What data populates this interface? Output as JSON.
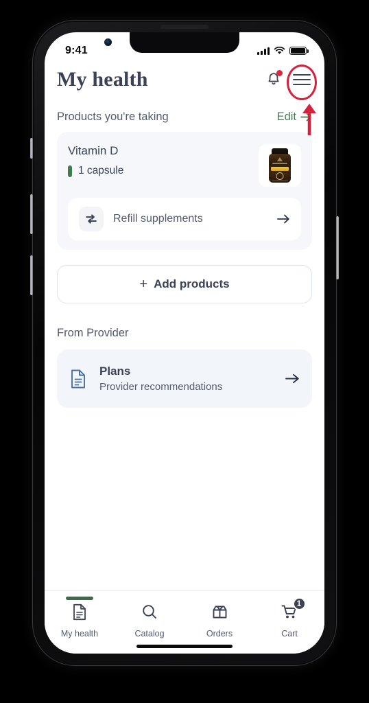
{
  "status_bar": {
    "time": "9:41",
    "signal_icon": "cellular-signal-icon",
    "wifi_icon": "wifi-icon",
    "battery_icon": "battery-full-icon"
  },
  "header": {
    "title": "My health",
    "notifications_icon": "bell-icon",
    "menu_icon": "hamburger-menu-icon",
    "has_notification_dot": true
  },
  "annotation": {
    "highlight_color": "#d4213c",
    "target": "hamburger-menu-icon",
    "shape": "ellipse-with-up-arrow"
  },
  "products_section": {
    "title": "Products you're taking",
    "edit_label": "Edit",
    "edit_arrow": "arrow-right-icon",
    "edit_color": "#4a7a5e",
    "items": [
      {
        "name": "Vitamin D",
        "dose": "1 capsule",
        "dose_marker_color": "#3f7a52",
        "thumbnail": "supplement-bottle-image"
      }
    ],
    "refill": {
      "label": "Refill supplements",
      "icon": "refresh-swap-icon",
      "arrow": "arrow-right-icon"
    },
    "add_button": {
      "plus": "+",
      "label": "Add products"
    }
  },
  "provider_section": {
    "title": "From Provider",
    "cards": [
      {
        "icon": "document-icon",
        "icon_color": "#4a6fa5",
        "title": "Plans",
        "subtitle": "Provider recommendations",
        "arrow": "arrow-right-icon"
      }
    ]
  },
  "tabbar": {
    "active_index": 0,
    "active_indicator_color": "#3f6b4a",
    "tabs": [
      {
        "label": "My health",
        "icon": "document-icon",
        "badge": ""
      },
      {
        "label": "Catalog",
        "icon": "search-icon",
        "badge": ""
      },
      {
        "label": "Orders",
        "icon": "open-box-icon",
        "badge": ""
      },
      {
        "label": "Cart",
        "icon": "shopping-cart-icon",
        "badge": "1"
      }
    ]
  }
}
